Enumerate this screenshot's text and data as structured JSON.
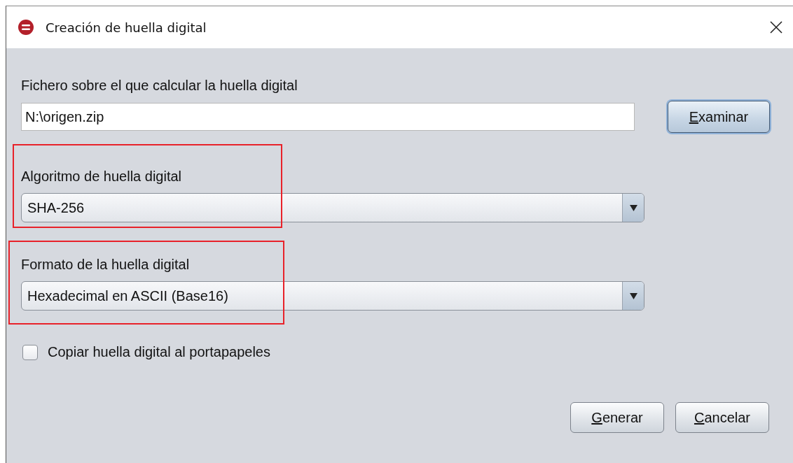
{
  "window": {
    "title": "Creación de huella digital"
  },
  "file": {
    "label": "Fichero sobre el que calcular la huella digital",
    "value": "N:\\origen.zip",
    "browse_button": {
      "label": "Examinar",
      "focused": true,
      "mnemonic_underlined": true
    }
  },
  "algorithm": {
    "label": "Algoritmo de huella digital",
    "value": "SHA-256",
    "highlighted": true
  },
  "format": {
    "label": "Formato de la huella digital",
    "value": "Hexadecimal en ASCII (Base16)",
    "highlighted": true
  },
  "copy_checkbox": {
    "label": "Copiar huella digital al portapapeles",
    "checked": false
  },
  "buttons": [
    {
      "label": "Generar",
      "focused": false,
      "mnemonic_underlined": true
    },
    {
      "label": "Cancelar",
      "focused": false,
      "mnemonic_underlined": true
    }
  ]
}
